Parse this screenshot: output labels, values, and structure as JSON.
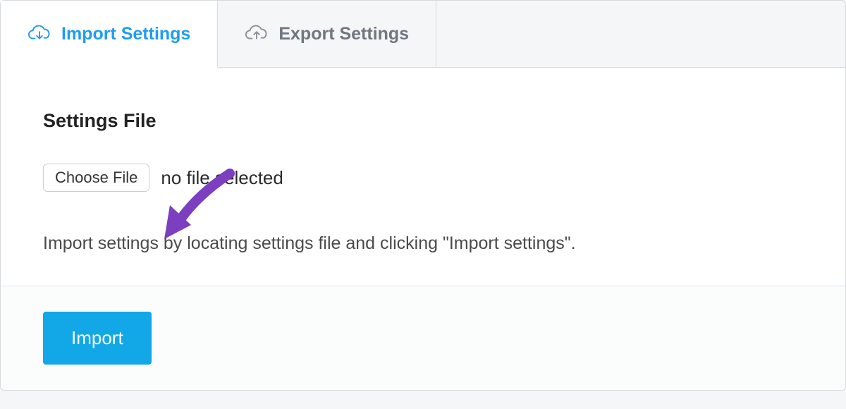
{
  "tabs": {
    "import": {
      "label": "Import Settings"
    },
    "export": {
      "label": "Export Settings"
    }
  },
  "section": {
    "title": "Settings File",
    "choose_label": "Choose File",
    "file_status": "no file selected",
    "help_text": "Import settings by locating settings file and clicking \"Import settings\"."
  },
  "footer": {
    "import_label": "Import"
  },
  "colors": {
    "accent": "#1e9df0",
    "button": "#12a7e6",
    "annotation": "#7b3fbf"
  }
}
